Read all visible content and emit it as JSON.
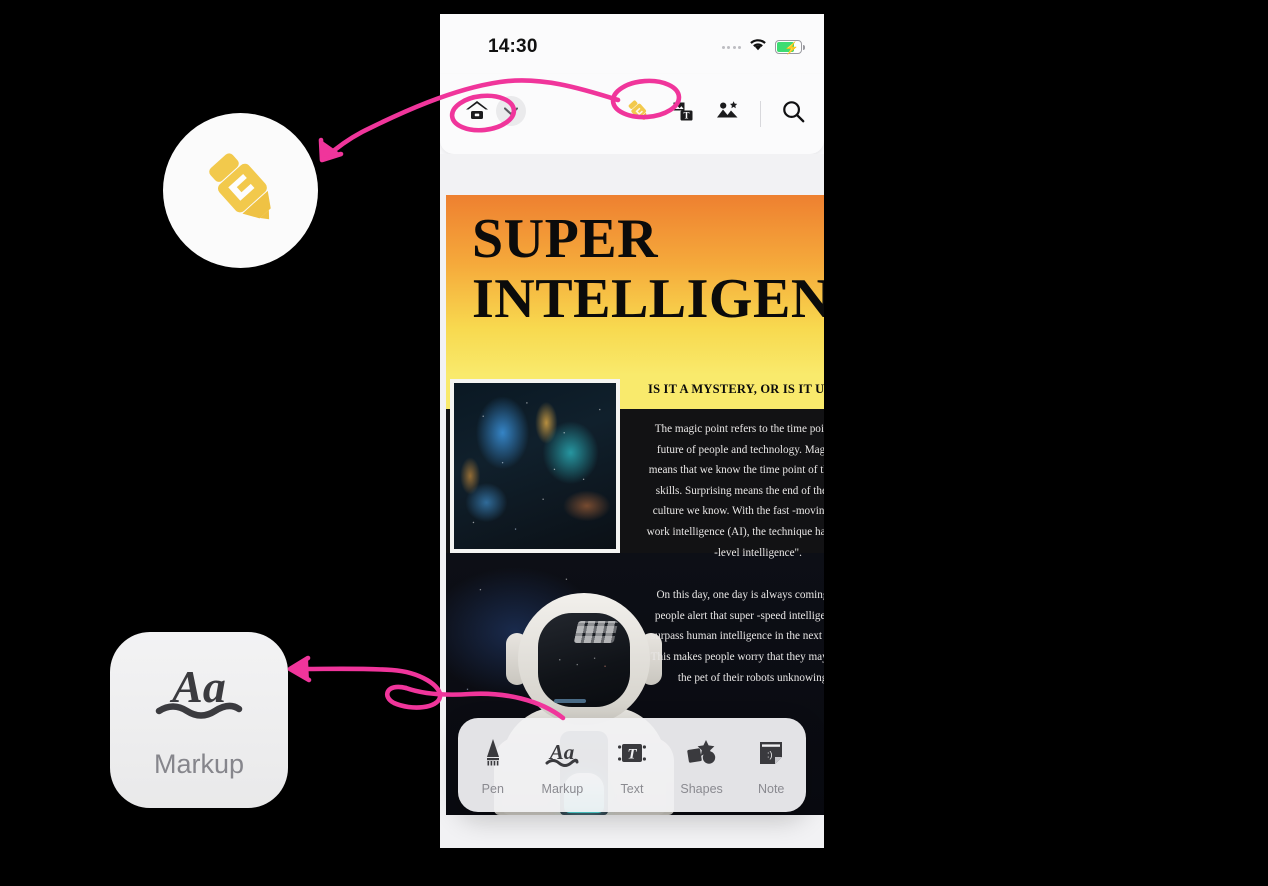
{
  "status_bar": {
    "time": "14:30",
    "signal_icon": "signal-dots-icon",
    "wifi_icon": "wifi-icon",
    "battery_icon": "battery-charging-icon"
  },
  "app_toolbar": {
    "home_icon": "home-icon",
    "chevron_icon": "chevron-down-icon",
    "highlighter_icon": "highlighter-icon",
    "image_to_text_icon": "image-to-text-icon",
    "image_star_icon": "image-magic-icon",
    "search_icon": "search-icon"
  },
  "document": {
    "title_line1": "SUPER",
    "title_line2": "INTELLIGENCE",
    "subtitle": "IS IT A MYSTERY, OR IS IT URGENT?",
    "nebula_image": "nebula-photo",
    "astronaut_image": "astronaut-robot-photo",
    "paragraphs": [
      "The magic point refers to the time point of the future of people and technology. Magic point means that we know the time point of the human skills. Surprising means the end of the human culture we know. With the fast -moving human work intelligence (AI), the technique has a \"super -level intelligence\".",
      "On this day, one day is always coming. Some people alert that super -speed intelligence will surpass human intelligence in the next 25 years. This makes people worry that they may become the pet of their robots unknowingly."
    ]
  },
  "tool_bar": {
    "tools": [
      {
        "label": "Pen",
        "icon": "pen-icon"
      },
      {
        "label": "Markup",
        "icon": "markup-icon"
      },
      {
        "label": "Text",
        "icon": "text-icon"
      },
      {
        "label": "Shapes",
        "icon": "shapes-icon"
      },
      {
        "label": "Note",
        "icon": "sticky-note-icon"
      }
    ]
  },
  "callouts": {
    "highlighter": {
      "icon": "highlighter-icon"
    },
    "markup": {
      "icon": "markup-icon",
      "label": "Markup"
    }
  },
  "colors": {
    "annotation_pink": "#F0359B",
    "highlighter_yellow": "#F2C94C",
    "poster_gradient_top": "#EE8030",
    "poster_gradient_bottom": "#F9EA6C",
    "battery_green": "#3DDC72"
  }
}
